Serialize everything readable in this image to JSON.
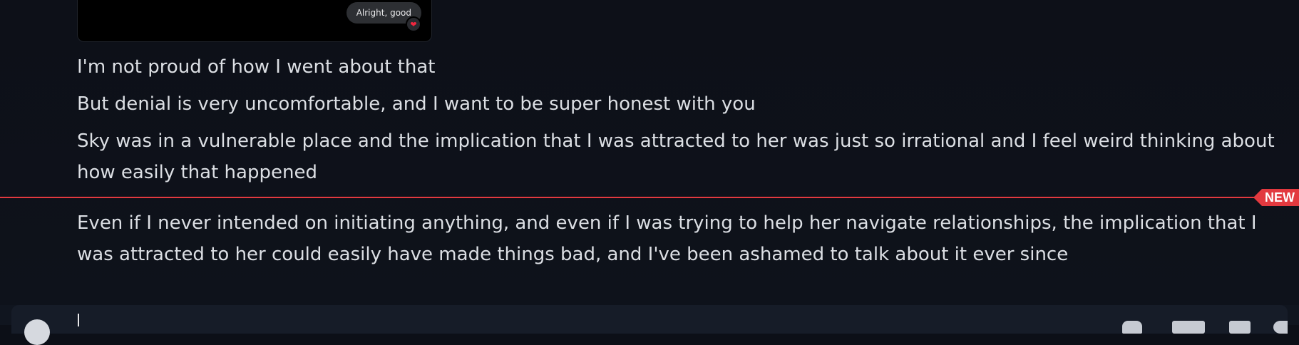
{
  "embed": {
    "reply_text": "Alright, good",
    "reaction_icon": "heart-icon",
    "reaction_glyph": "❤",
    "reaction_color": "#f1273f"
  },
  "messages": [
    "I'm not proud of how I went about that",
    "But denial is very uncomfortable, and I want to be super honest with you",
    "Sky was in a vulnerable place and the implication that I was attracted to her was just so irrational and I feel weird thinking about how easily that happened",
    "Even if I never intended on initiating anything, and even if I was trying to help her navigate relationships, the implication that I was attracted to her could easily have made things bad, and I've been ashamed to talk about it ever since"
  ],
  "divider": {
    "badge_label": "NEW",
    "color": "#e2393f"
  },
  "composer": {
    "add_icon": "plus-circle-icon",
    "tool_icons": [
      "gift-icon",
      "gif-icon",
      "sticker-icon",
      "emoji-icon"
    ]
  }
}
